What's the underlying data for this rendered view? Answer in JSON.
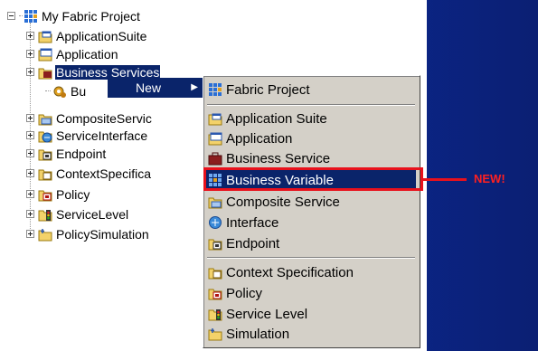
{
  "tree": {
    "root_label": "My Fabric Project",
    "items": [
      {
        "label": "ApplicationSuite",
        "icon": "application-suite-icon"
      },
      {
        "label": "Application",
        "icon": "application-icon"
      },
      {
        "label": "Business Services",
        "icon": "business-service-folder-icon",
        "selected": true
      },
      {
        "label": "Bu",
        "icon": "business-variable-gear-icon"
      },
      {
        "label": "CompositeServic",
        "icon": "composite-service-icon"
      },
      {
        "label": "ServiceInterface",
        "icon": "interface-icon"
      },
      {
        "label": "Endpoint",
        "icon": "endpoint-icon"
      },
      {
        "label": "ContextSpecifica",
        "icon": "context-spec-icon"
      },
      {
        "label": "Policy",
        "icon": "policy-icon"
      },
      {
        "label": "ServiceLevel",
        "icon": "service-level-icon"
      },
      {
        "label": "PolicySimulation",
        "icon": "simulation-icon"
      }
    ]
  },
  "context_menu": {
    "new_label": "New"
  },
  "submenu": {
    "items": [
      {
        "label": "Fabric Project",
        "icon": "fabric-project-icon"
      },
      {
        "label": "Application Suite",
        "icon": "application-suite-icon"
      },
      {
        "label": "Application",
        "icon": "application-icon"
      },
      {
        "label": "Business Service",
        "icon": "business-service-icon"
      },
      {
        "label": "Business Variable",
        "icon": "business-variable-icon",
        "highlighted": true
      },
      {
        "label": "Composite Service",
        "icon": "composite-service-icon"
      },
      {
        "label": "Interface",
        "icon": "interface-icon"
      },
      {
        "label": "Endpoint",
        "icon": "endpoint-icon"
      },
      {
        "label": "Context Specification",
        "icon": "context-spec-icon"
      },
      {
        "label": "Policy",
        "icon": "policy-icon"
      },
      {
        "label": "Service Level",
        "icon": "service-level-icon"
      },
      {
        "label": "Simulation",
        "icon": "simulation-icon"
      }
    ]
  },
  "callout": {
    "text": "NEW!",
    "color": "#e8111c"
  },
  "colors": {
    "selection": "#0a246a",
    "menu_bg": "#d4d0c8",
    "background": "#0a2a96"
  }
}
